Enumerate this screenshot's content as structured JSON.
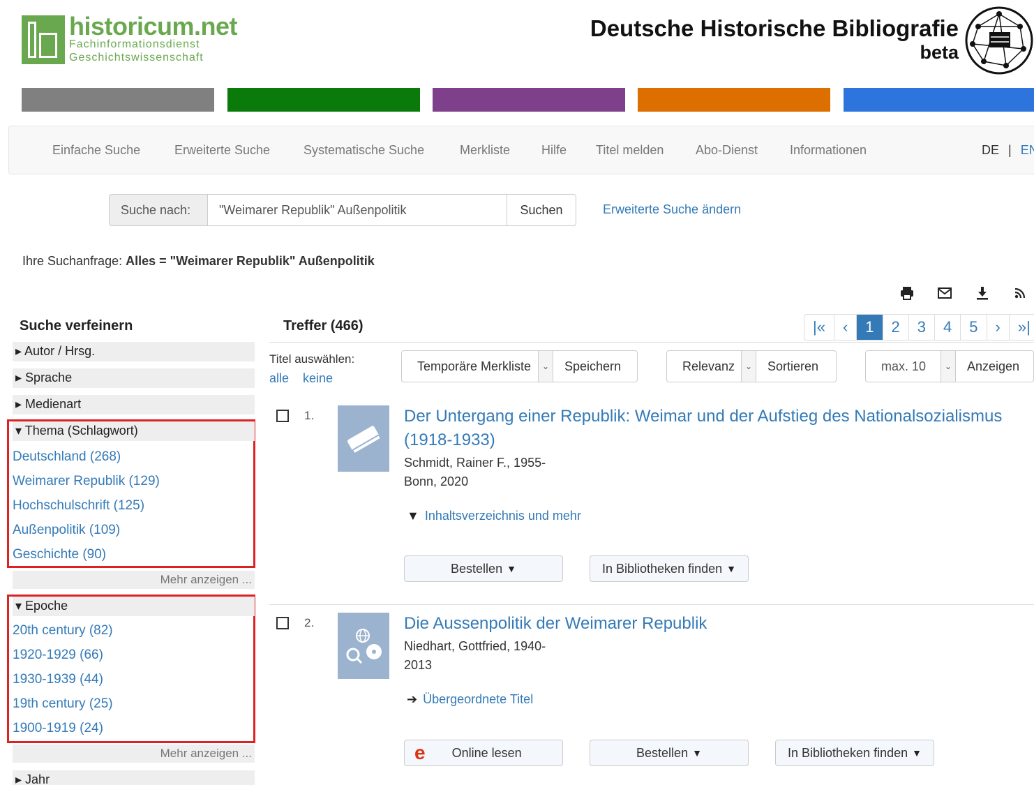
{
  "brand": {
    "title": "historicum.net",
    "sub1": "Fachinformationsdienst",
    "sub2": "Geschichtswissenschaft",
    "green": "#6aa84f"
  },
  "site": {
    "title": "Deutsche Historische Bibliografie",
    "beta": "beta"
  },
  "color_bars": [
    "#808080",
    "#0a7a0a",
    "#7e3f8b",
    "#dd6f00",
    "#2d75dd"
  ],
  "nav": {
    "items": [
      "Einfache Suche",
      "Erweiterte Suche",
      "Systematische Suche",
      "Merkliste",
      "Hilfe",
      "Titel melden",
      "Abo-Dienst",
      "Informationen"
    ],
    "lang_de": "DE",
    "lang_sep": "|",
    "lang_en": "EN"
  },
  "search": {
    "label": "Suche nach:",
    "value": "\"Weimarer Republik\" Außenpolitik",
    "button": "Suchen",
    "advanced_link": "Erweiterte Suche ändern"
  },
  "query": {
    "prefix": "Ihre Suchanfrage:",
    "text": "Alles = \"Weimarer Republik\" Außenpolitik"
  },
  "toolbar_icons": [
    "print-icon",
    "mail-icon",
    "download-icon",
    "rss-icon"
  ],
  "facets": {
    "title": "Suche verfeinern",
    "groups": [
      {
        "label": "Autor / Hrsg.",
        "expanded": false
      },
      {
        "label": "Sprache",
        "expanded": false
      },
      {
        "label": "Medienart",
        "expanded": false
      },
      {
        "label": "Thema (Schlagwort)",
        "expanded": true,
        "items": [
          "Deutschland (268)",
          "Weimarer Republik (129)",
          "Hochschulschrift (125)",
          "Außenpolitik (109)",
          "Geschichte (90)"
        ],
        "more": "Mehr anzeigen ..."
      },
      {
        "label": "Epoche",
        "expanded": true,
        "items": [
          "20th century (82)",
          "1920-1929 (66)",
          "1930-1939 (44)",
          "19th century (25)",
          "1900-1919 (24)"
        ],
        "more": "Mehr anzeigen ..."
      },
      {
        "label": "Jahr",
        "expanded": false
      }
    ],
    "highlight_color": "#dd2222"
  },
  "results": {
    "hits": "Treffer (466)",
    "pager": [
      "|«",
      "‹",
      "1",
      "2",
      "3",
      "4",
      "5",
      "›",
      "»|"
    ],
    "current_page": "1",
    "select_label": "Titel auswählen:",
    "select_all": "alle",
    "select_none": "keine",
    "list_select": "Temporäre Merkliste",
    "save": "Speichern",
    "sort_select": "Relevanz",
    "sort_btn": "Sortieren",
    "per_page_select": "max. 10",
    "show_btn": "Anzeigen",
    "items": [
      {
        "num": "1.",
        "title": "Der Untergang einer Republik: Weimar und der Aufstieg des Nationalsozialismus (1918-1933)",
        "author": "Schmidt, Rainer F., 1955-",
        "pub": "Bonn, 2020",
        "toggle": "Inhaltsverzeichnis und mehr",
        "order": "Bestellen",
        "find": "In Bibliotheken finden",
        "thumb": "book-icon"
      },
      {
        "num": "2.",
        "title": "Die Aussenpolitik der Weimarer Republik",
        "author": "Niedhart, Gottfried, 1940-",
        "pub": "2013",
        "toggle": "Übergeordnete Titel",
        "online": "Online lesen",
        "order": "Bestellen",
        "find": "In Bibliotheken finden",
        "thumb": "online-resource-icon"
      }
    ]
  }
}
